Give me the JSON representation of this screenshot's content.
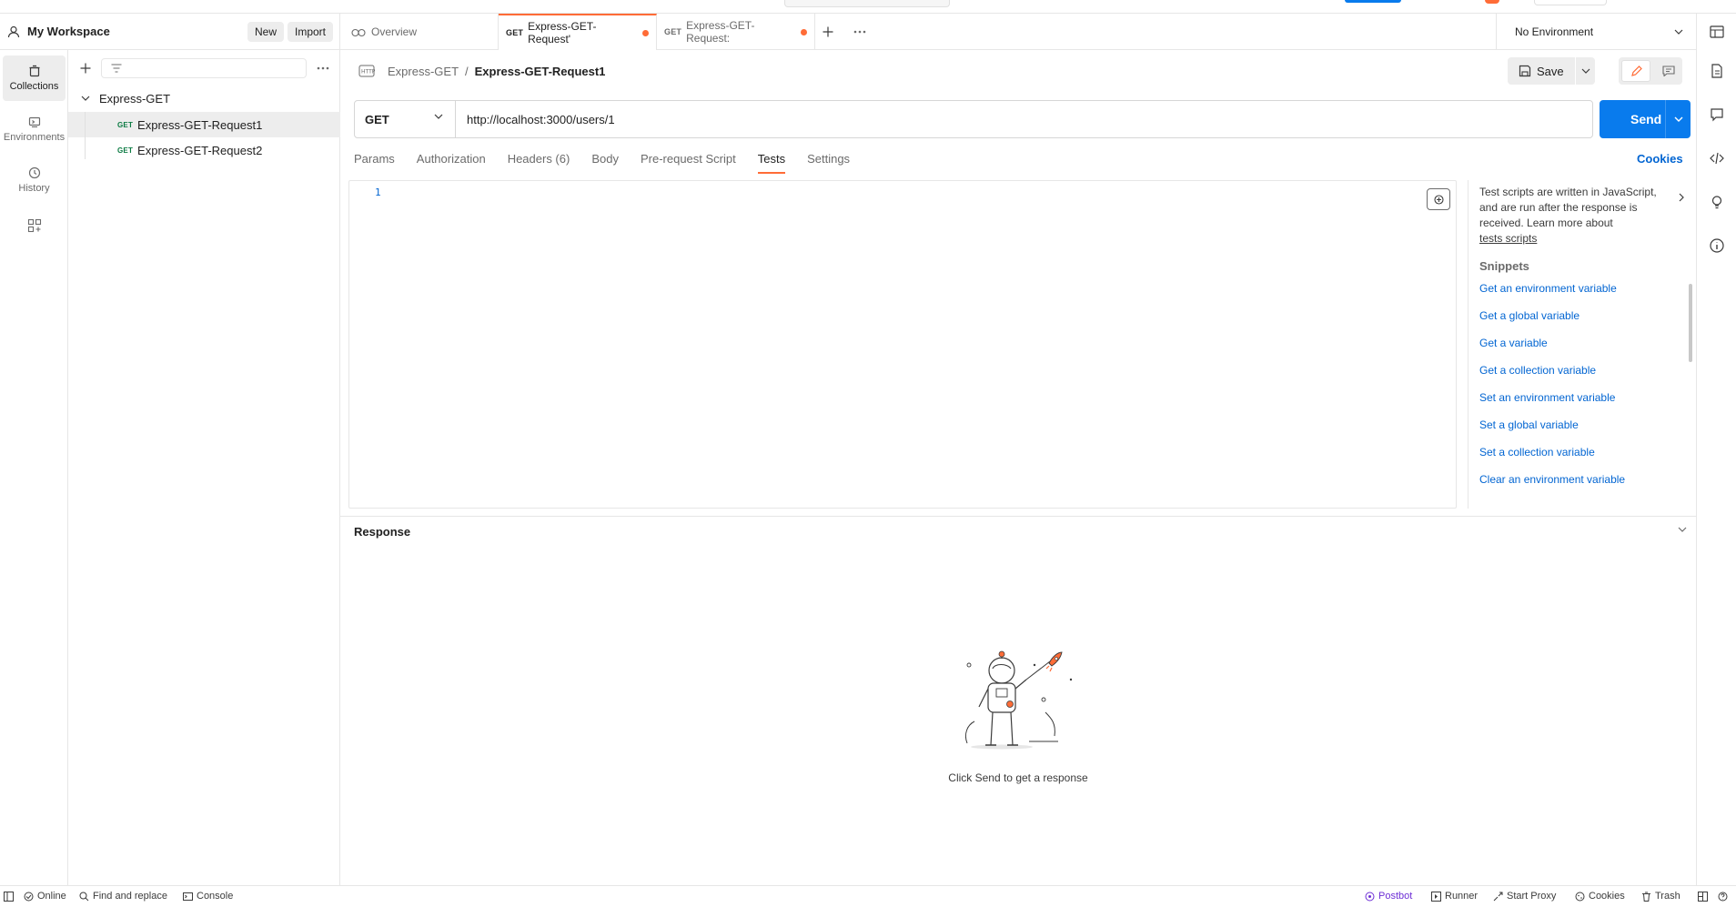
{
  "workspace": {
    "name": "My Workspace",
    "new_label": "New",
    "import_label": "Import"
  },
  "rail": {
    "collections": "Collections",
    "environments": "Environments",
    "history": "History"
  },
  "tree": {
    "collection": "Express-GET",
    "requests": [
      {
        "method": "GET",
        "name": "Express-GET-Request1"
      },
      {
        "method": "GET",
        "name": "Express-GET-Request2"
      }
    ]
  },
  "tabs": {
    "overview": "Overview",
    "items": [
      {
        "method": "GET",
        "name": "Express-GET-Request'"
      },
      {
        "method": "GET",
        "name": "Express-GET-Request:"
      }
    ]
  },
  "environment": {
    "selected": "No Environment"
  },
  "request": {
    "breadcrumb_parent": "Express-GET",
    "breadcrumb_sep": "/",
    "breadcrumb_current": "Express-GET-Request1",
    "save_label": "Save",
    "method": "GET",
    "url": "http://localhost:3000/users/1",
    "send_label": "Send"
  },
  "subtabs": {
    "params": "Params",
    "authorization": "Authorization",
    "headers": "Headers (6)",
    "body": "Body",
    "prerequest": "Pre-request Script",
    "tests": "Tests",
    "settings": "Settings",
    "cookies": "Cookies"
  },
  "editor": {
    "line": "1"
  },
  "snippets": {
    "desc": "Test scripts are written in JavaScript, and are run after the response is received. Learn more about",
    "learn_link": "tests scripts",
    "title": "Snippets",
    "items": [
      "Get an environment variable",
      "Get a global variable",
      "Get a variable",
      "Get a collection variable",
      "Set an environment variable",
      "Set a global variable",
      "Set a collection variable",
      "Clear an environment variable"
    ]
  },
  "response": {
    "title": "Response",
    "hint": "Click Send to get a response"
  },
  "status": {
    "online": "Online",
    "find": "Find and replace",
    "console": "Console",
    "postbot": "Postbot",
    "runner": "Runner",
    "proxy": "Start Proxy",
    "cookies": "Cookies",
    "trash": "Trash"
  },
  "colors": {
    "accent": "#ff6c37",
    "primary": "#097bed",
    "link": "#0265d2",
    "get_method": "#0c7b43"
  }
}
